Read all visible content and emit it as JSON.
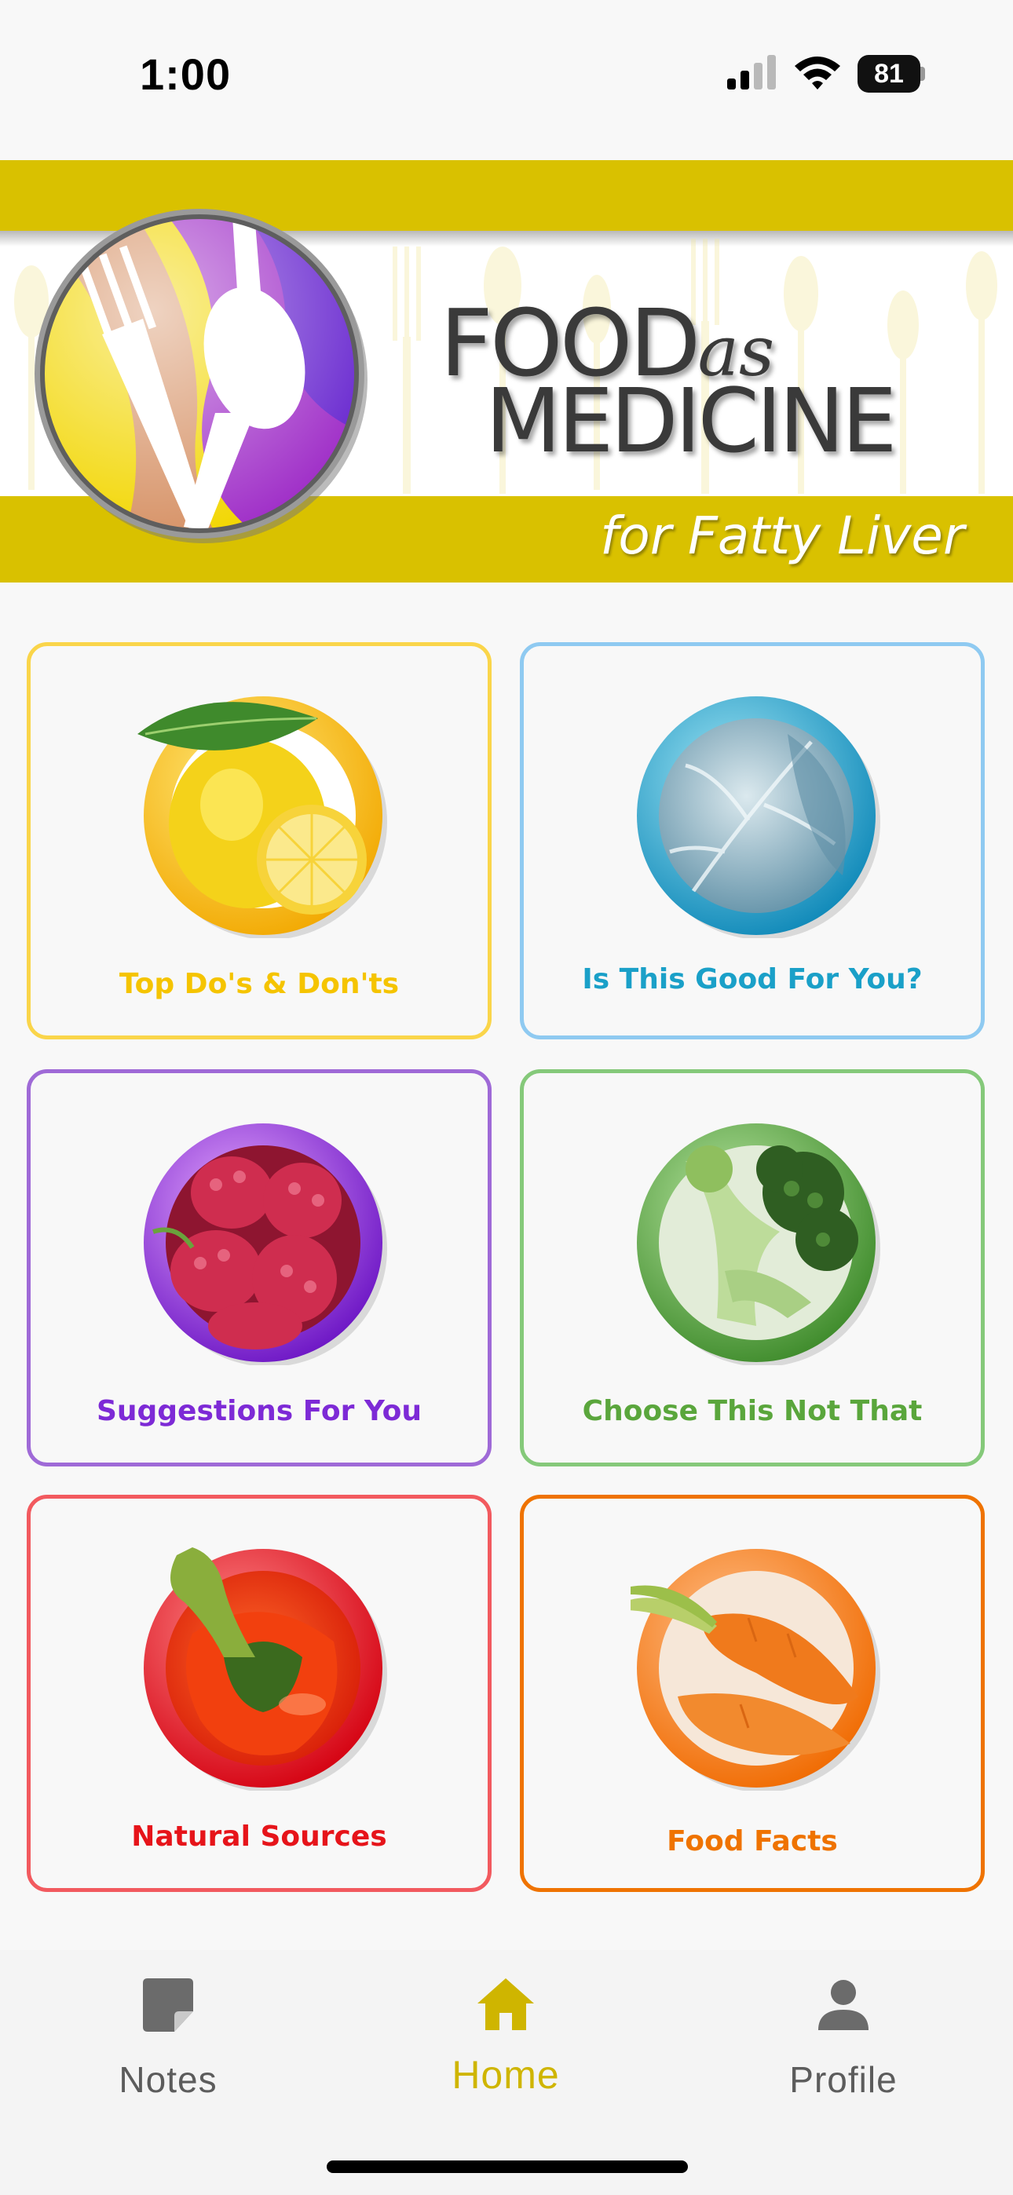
{
  "status_bar": {
    "time": "1:00",
    "battery": "81",
    "icons": [
      "signal-icon",
      "wifi-icon",
      "battery-icon"
    ]
  },
  "banner": {
    "title_line1": "FOOD",
    "title_as": "as",
    "title_line2": "MEDICINE",
    "subtitle": "for Fatty Liver",
    "colors": {
      "band": "#d9c100",
      "logo_yellow": "#f2d600",
      "logo_purple": "#8a2fc8"
    }
  },
  "tiles": [
    {
      "label": "Top Do's & Don'ts",
      "icon": "lemon-icon",
      "color": "#f5c400"
    },
    {
      "label": "Is This Good For You?",
      "icon": "cabbage-icon",
      "color": "#1aa0c8"
    },
    {
      "label": "Suggestions For You",
      "icon": "raspberry-icon",
      "color": "#7d2ad6"
    },
    {
      "label": "Choose This Not That",
      "icon": "broccoli-icon",
      "color": "#5aa63c"
    },
    {
      "label": "Natural Sources",
      "icon": "pepper-icon",
      "color": "#e6141a"
    },
    {
      "label": "Food Facts",
      "icon": "carrot-icon",
      "color": "#ef7300"
    }
  ],
  "tab_bar": {
    "tabs": [
      {
        "label": "Notes",
        "icon": "note-icon",
        "active": false
      },
      {
        "label": "Home",
        "icon": "home-icon",
        "active": true
      },
      {
        "label": "Profile",
        "icon": "person-icon",
        "active": false
      }
    ],
    "active_color": "#cfb500"
  }
}
